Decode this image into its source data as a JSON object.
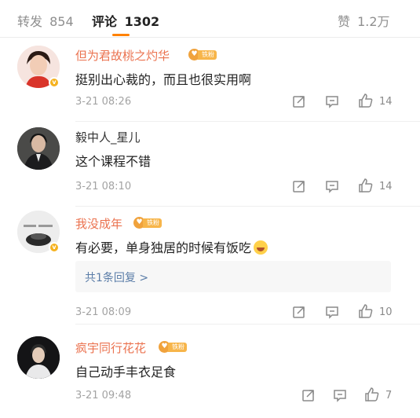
{
  "tabs": {
    "repost_label": "转发",
    "repost_count": "854",
    "comment_label": "评论",
    "comment_count": "1302",
    "like_label": "赞",
    "like_count": "1.2万"
  },
  "fan_badge_label": "铁粉",
  "comments": [
    {
      "username": "但为君故桃之灼华",
      "text": "挺别出心裁的，而且也很实用啊",
      "time": "3-21 08:26",
      "likes": "14"
    },
    {
      "username": "毅中人_星儿",
      "text": "这个课程不错",
      "time": "3-21 08:10",
      "likes": "14"
    },
    {
      "username": "我没成年",
      "text": "有必要，单身独居的时候有饭吃",
      "reply_summary": "共1条回复 >",
      "time": "3-21 08:09",
      "likes": "10"
    },
    {
      "username": "疯宇同行花花",
      "text": "自己动手丰衣足食",
      "time": "3-21 09:48",
      "likes": "7"
    }
  ],
  "icons": {
    "repost": "repost-icon",
    "reply": "comment-icon",
    "like": "thumbs-up-icon",
    "verified": "verified-badge-icon",
    "fan": "fan-heart-icon",
    "emoji": "laugh-cry-emoji-icon"
  },
  "colors": {
    "accent": "#ff8200",
    "username_highlight": "#eb7350",
    "link": "#5b7da8",
    "muted": "#a3a3a3"
  }
}
